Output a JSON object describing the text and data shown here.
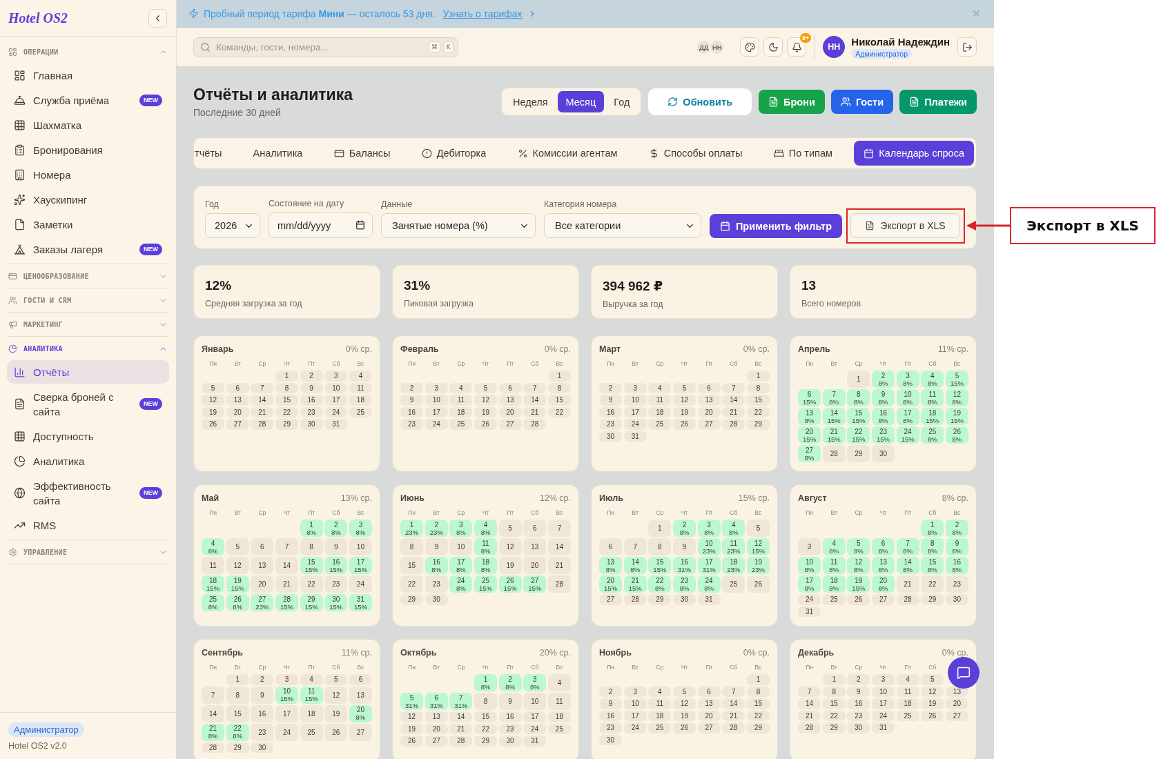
{
  "sidebar": {
    "logo": "Hotel OS2",
    "sections": [
      {
        "title": "ОПЕРАЦИИ",
        "expanded": true,
        "items": [
          {
            "label": "Главная",
            "selected": false
          },
          {
            "label": "Служба приёма",
            "badge": "NEW",
            "selected": false
          },
          {
            "label": "Шахматка",
            "selected": false
          },
          {
            "label": "Бронирования",
            "selected": false
          },
          {
            "label": "Номера",
            "selected": false
          },
          {
            "label": "Хаускипинг",
            "selected": false
          },
          {
            "label": "Заметки",
            "selected": false
          },
          {
            "label": "Заказы лагеря",
            "badge": "NEW",
            "selected": false
          }
        ]
      },
      {
        "title": "ЦЕНООБРАЗОВАНИЕ",
        "expanded": false
      },
      {
        "title": "ГОСТИ И CRM",
        "expanded": false
      },
      {
        "title": "МАРКЕТИНГ",
        "expanded": false
      },
      {
        "title": "АНАЛИТИКА",
        "expanded": true,
        "items": [
          {
            "label": "Отчёты",
            "selected": true
          },
          {
            "label": "Сверка броней с сайта",
            "badge": "NEW",
            "selected": false
          },
          {
            "label": "Доступность",
            "selected": false
          },
          {
            "label": "Аналитика",
            "selected": false
          },
          {
            "label": "Эффективность сайта",
            "badge": "NEW",
            "selected": false
          },
          {
            "label": "RMS",
            "selected": false
          }
        ]
      },
      {
        "title": "УПРАВЛЕНИЕ",
        "expanded": false
      }
    ],
    "footer": {
      "role": "Администратор",
      "version": "Hotel OS2 v2.0"
    }
  },
  "banner": {
    "text": "Пробный период тарифа **Мини** — осталось 53 дня.",
    "link": "Узнать о тарифах"
  },
  "header": {
    "search": {
      "placeholder": "Команды, гости, номера...",
      "keys": [
        "⌘",
        "K"
      ]
    },
    "presence": [
      "ДД",
      "НН"
    ],
    "notifications": "9+",
    "user": {
      "initials": "НН",
      "name": "Николай Надеждин",
      "role": "Администратор"
    }
  },
  "page": {
    "title": "Отчёты и аналитика",
    "subtitle": "Последние 30 дней",
    "periods": [
      {
        "label": "Неделя",
        "selected": false
      },
      {
        "label": "Месяц",
        "selected": true
      },
      {
        "label": "Год",
        "selected": false
      }
    ],
    "actions": [
      {
        "label": "Обновить",
        "kind": "refresh",
        "color": "#13819e"
      },
      {
        "label": "Брони",
        "kind": "bookings",
        "color": "#16a34a"
      },
      {
        "label": "Гости",
        "kind": "guests",
        "color": "#2563eb"
      },
      {
        "label": "Платежи",
        "kind": "payments",
        "color": "#059669"
      }
    ]
  },
  "tabs": [
    {
      "label": "тчёты",
      "selected": false
    },
    {
      "label": "Аналитика",
      "selected": false
    },
    {
      "label": "Балансы",
      "selected": false
    },
    {
      "label": "Дебиторка",
      "selected": false
    },
    {
      "label": "Комиссии агентам",
      "selected": false
    },
    {
      "label": "Способы оплаты",
      "selected": false
    },
    {
      "label": "По типам",
      "selected": false
    },
    {
      "label": "Календарь спроса",
      "selected": true
    }
  ],
  "filters": {
    "fields": [
      {
        "label": "Год",
        "kind": "select",
        "value": "2026"
      },
      {
        "label": "Состояние на дату",
        "kind": "date",
        "placeholder": "mm/dd/yyyy"
      },
      {
        "label": "Данные",
        "kind": "select",
        "value": "Занятые номера (%)"
      },
      {
        "label": "Категория номера",
        "kind": "select",
        "value": "Все категории"
      }
    ],
    "apply": "Применить фильтр",
    "export": "Экспорт в XLS"
  },
  "stats": [
    {
      "value": "12%",
      "label": "Средняя загрузка за год"
    },
    {
      "value": "31%",
      "label": "Пиковая загрузка"
    },
    {
      "value": "394 962 ₽",
      "label": "Выручка за год"
    },
    {
      "value": "13",
      "label": "Всего номеров"
    }
  ],
  "calendar": {
    "months": [
      {
        "name": "Январь",
        "average": "0% ср.",
        "weekdays": [
          "Пн",
          "Вт",
          "Ср",
          "Чт",
          "Пт",
          "Сб",
          "Вс"
        ],
        "days": [
          [
            "1"
          ],
          [
            "2"
          ],
          [
            "3"
          ],
          [
            "4"
          ],
          [
            "5"
          ],
          [
            "6"
          ],
          [
            "7"
          ],
          [
            "8"
          ],
          [
            "9"
          ],
          [
            "10"
          ],
          [
            "11"
          ],
          [
            "12"
          ],
          [
            "13"
          ],
          [
            "14"
          ],
          [
            "15"
          ],
          [
            "16"
          ],
          [
            "17"
          ],
          [
            "18"
          ],
          [
            "19"
          ],
          [
            "20"
          ],
          [
            "21"
          ],
          [
            "22"
          ],
          [
            "23"
          ],
          [
            "24"
          ],
          [
            "25"
          ],
          [
            "26"
          ],
          [
            "27"
          ],
          [
            "28"
          ],
          [
            "29"
          ],
          [
            "30"
          ],
          [
            "31"
          ]
        ]
      },
      {
        "name": "Февраль",
        "average": "0% ср.",
        "weekdays": [
          "Пн",
          "Вт",
          "Ср",
          "Чт",
          "Пт",
          "Сб",
          "Вс"
        ],
        "days": [
          [
            "1"
          ],
          [
            "2"
          ],
          [
            "3"
          ],
          [
            "4"
          ],
          [
            "5"
          ],
          [
            "6"
          ],
          [
            "7"
          ],
          [
            "8"
          ],
          [
            "9"
          ],
          [
            "10"
          ],
          [
            "11"
          ],
          [
            "12"
          ],
          [
            "13"
          ],
          [
            "14"
          ],
          [
            "15"
          ],
          [
            "16"
          ],
          [
            "17"
          ],
          [
            "18"
          ],
          [
            "19"
          ],
          [
            "20"
          ],
          [
            "21"
          ],
          [
            "22"
          ],
          [
            "23"
          ],
          [
            "24"
          ],
          [
            "25"
          ],
          [
            "26"
          ],
          [
            "27"
          ],
          [
            "28"
          ]
        ]
      },
      {
        "name": "Март",
        "average": "0% ср.",
        "weekdays": [
          "Пн",
          "Вт",
          "Ср",
          "Чт",
          "Пт",
          "Сб",
          "Вс"
        ],
        "days": [
          [
            "1"
          ],
          [
            "2"
          ],
          [
            "3"
          ],
          [
            "4"
          ],
          [
            "5"
          ],
          [
            "6"
          ],
          [
            "7"
          ],
          [
            "8"
          ],
          [
            "9"
          ],
          [
            "10"
          ],
          [
            "11"
          ],
          [
            "12"
          ],
          [
            "13"
          ],
          [
            "14"
          ],
          [
            "15"
          ],
          [
            "16"
          ],
          [
            "17"
          ],
          [
            "18"
          ],
          [
            "19"
          ],
          [
            "20"
          ],
          [
            "21"
          ],
          [
            "22"
          ],
          [
            "23"
          ],
          [
            "24"
          ],
          [
            "25"
          ],
          [
            "26"
          ],
          [
            "27"
          ],
          [
            "28"
          ],
          [
            "29"
          ],
          [
            "30"
          ],
          [
            "31"
          ]
        ]
      },
      {
        "name": "Апрель",
        "average": "11% ср.",
        "weekdays": [
          "Пн",
          "Вт",
          "Ср",
          "Чт",
          "Пт",
          "Сб",
          "Вс"
        ],
        "days": [
          [
            "1"
          ],
          [
            "2",
            "8%"
          ],
          [
            "3",
            "8%"
          ],
          [
            "4",
            "8%"
          ],
          [
            "5",
            "15%"
          ],
          [
            "6",
            "15%"
          ],
          [
            "7",
            "8%"
          ],
          [
            "8",
            "8%"
          ],
          [
            "9",
            "8%"
          ],
          [
            "10",
            "8%"
          ],
          [
            "11",
            "8%"
          ],
          [
            "12",
            "8%"
          ],
          [
            "13",
            "8%"
          ],
          [
            "14",
            "15%"
          ],
          [
            "15",
            "15%"
          ],
          [
            "16",
            "8%"
          ],
          [
            "17",
            "8%"
          ],
          [
            "18",
            "15%"
          ],
          [
            "19",
            "15%"
          ],
          [
            "20",
            "15%"
          ],
          [
            "21",
            "15%"
          ],
          [
            "22",
            "15%"
          ],
          [
            "23",
            "15%"
          ],
          [
            "24",
            "15%"
          ],
          [
            "25",
            "8%"
          ],
          [
            "26",
            "8%"
          ],
          [
            "27",
            "8%"
          ],
          [
            "28"
          ],
          [
            "29"
          ],
          [
            "30"
          ]
        ]
      },
      {
        "name": "Май",
        "average": "13% ср.",
        "weekdays": [
          "Пн",
          "Вт",
          "Ср",
          "Чт",
          "Пт",
          "Сб",
          "Вс"
        ],
        "days": [
          [
            "1",
            "8%"
          ],
          [
            "2",
            "8%"
          ],
          [
            "3",
            "8%"
          ],
          [
            "4",
            "8%"
          ],
          [
            "5"
          ],
          [
            "6"
          ],
          [
            "7"
          ],
          [
            "8"
          ],
          [
            "9"
          ],
          [
            "10"
          ],
          [
            "11"
          ],
          [
            "12"
          ],
          [
            "13"
          ],
          [
            "14"
          ],
          [
            "15",
            "15%"
          ],
          [
            "16",
            "15%"
          ],
          [
            "17",
            "15%"
          ],
          [
            "18",
            "15%"
          ],
          [
            "19",
            "15%"
          ],
          [
            "20"
          ],
          [
            "21"
          ],
          [
            "22"
          ],
          [
            "23"
          ],
          [
            "24"
          ],
          [
            "25",
            "8%"
          ],
          [
            "26",
            "8%"
          ],
          [
            "27",
            "23%"
          ],
          [
            "28",
            "15%"
          ],
          [
            "29",
            "15%"
          ],
          [
            "30",
            "15%"
          ],
          [
            "31",
            "15%"
          ]
        ]
      },
      {
        "name": "Июнь",
        "average": "12% ср.",
        "weekdays": [
          "Пн",
          "Вт",
          "Ср",
          "Чт",
          "Пт",
          "Сб",
          "Вс"
        ],
        "days": [
          [
            "1",
            "23%"
          ],
          [
            "2",
            "23%"
          ],
          [
            "3",
            "8%"
          ],
          [
            "4",
            "8%"
          ],
          [
            "5"
          ],
          [
            "6"
          ],
          [
            "7"
          ],
          [
            "8"
          ],
          [
            "9"
          ],
          [
            "10"
          ],
          [
            "11",
            "8%"
          ],
          [
            "12"
          ],
          [
            "13"
          ],
          [
            "14"
          ],
          [
            "15"
          ],
          [
            "16",
            "8%"
          ],
          [
            "17",
            "8%"
          ],
          [
            "18",
            "8%"
          ],
          [
            "19"
          ],
          [
            "20"
          ],
          [
            "21"
          ],
          [
            "22"
          ],
          [
            "23"
          ],
          [
            "24",
            "8%"
          ],
          [
            "25",
            "15%"
          ],
          [
            "26",
            "15%"
          ],
          [
            "27",
            "15%"
          ],
          [
            "28"
          ],
          [
            "29"
          ],
          [
            "30"
          ]
        ]
      },
      {
        "name": "Июль",
        "average": "15% ср.",
        "weekdays": [
          "Пн",
          "Вт",
          "Ср",
          "Чт",
          "Пт",
          "Сб",
          "Вс"
        ],
        "days": [
          [
            "1"
          ],
          [
            "2",
            "8%"
          ],
          [
            "3",
            "8%"
          ],
          [
            "4",
            "8%"
          ],
          [
            "5"
          ],
          [
            "6"
          ],
          [
            "7"
          ],
          [
            "8"
          ],
          [
            "9"
          ],
          [
            "10",
            "23%"
          ],
          [
            "11",
            "23%"
          ],
          [
            "12",
            "15%"
          ],
          [
            "13",
            "8%"
          ],
          [
            "14",
            "8%"
          ],
          [
            "15",
            "15%"
          ],
          [
            "16",
            "31%"
          ],
          [
            "17",
            "31%"
          ],
          [
            "18",
            "23%"
          ],
          [
            "19",
            "23%"
          ],
          [
            "20",
            "15%"
          ],
          [
            "21",
            "15%"
          ],
          [
            "22",
            "8%"
          ],
          [
            "23",
            "8%"
          ],
          [
            "24",
            "8%"
          ],
          [
            "25"
          ],
          [
            "26"
          ],
          [
            "27"
          ],
          [
            "28"
          ],
          [
            "29"
          ],
          [
            "30"
          ],
          [
            "31"
          ]
        ]
      },
      {
        "name": "Август",
        "average": "8% ср.",
        "weekdays": [
          "Пн",
          "Вт",
          "Ср",
          "Чт",
          "Пт",
          "Сб",
          "Вс"
        ],
        "days": [
          [
            "1",
            "8%"
          ],
          [
            "2",
            "8%"
          ],
          [
            "3"
          ],
          [
            "4",
            "8%"
          ],
          [
            "5",
            "8%"
          ],
          [
            "6",
            "8%"
          ],
          [
            "7",
            "8%"
          ],
          [
            "8",
            "8%"
          ],
          [
            "9",
            "8%"
          ],
          [
            "10",
            "8%"
          ],
          [
            "11",
            "8%"
          ],
          [
            "12",
            "8%"
          ],
          [
            "13",
            "8%"
          ],
          [
            "14",
            "8%"
          ],
          [
            "15",
            "8%"
          ],
          [
            "16",
            "8%"
          ],
          [
            "17",
            "8%"
          ],
          [
            "18",
            "8%"
          ],
          [
            "19",
            "15%"
          ],
          [
            "20",
            "8%"
          ],
          [
            "21"
          ],
          [
            "22"
          ],
          [
            "23"
          ],
          [
            "24"
          ],
          [
            "25"
          ],
          [
            "26"
          ],
          [
            "27"
          ],
          [
            "28"
          ],
          [
            "29"
          ],
          [
            "30"
          ],
          [
            "31"
          ]
        ]
      },
      {
        "name": "Сентябрь",
        "average": "11% ср.",
        "weekdays": [
          "Пн",
          "Вт",
          "Ср",
          "Чт",
          "Пт",
          "Сб",
          "Вс"
        ],
        "days": [
          [
            "1"
          ],
          [
            "2"
          ],
          [
            "3"
          ],
          [
            "4"
          ],
          [
            "5"
          ],
          [
            "6"
          ],
          [
            "7"
          ],
          [
            "8"
          ],
          [
            "9"
          ],
          [
            "10",
            "15%"
          ],
          [
            "11",
            "15%"
          ],
          [
            "12"
          ],
          [
            "13"
          ],
          [
            "14"
          ],
          [
            "15"
          ],
          [
            "16"
          ],
          [
            "17"
          ],
          [
            "18"
          ],
          [
            "19"
          ],
          [
            "20",
            "8%"
          ],
          [
            "21",
            "8%"
          ],
          [
            "22",
            "8%"
          ],
          [
            "23"
          ],
          [
            "24"
          ],
          [
            "25"
          ],
          [
            "26"
          ],
          [
            "27"
          ],
          [
            "28"
          ],
          [
            "29"
          ],
          [
            "30"
          ]
        ]
      },
      {
        "name": "Октябрь",
        "average": "20% ср.",
        "weekdays": [
          "Пн",
          "Вт",
          "Ср",
          "Чт",
          "Пт",
          "Сб",
          "Вс"
        ],
        "days": [
          [
            "1",
            "8%"
          ],
          [
            "2",
            "8%"
          ],
          [
            "3",
            "8%"
          ],
          [
            "4"
          ],
          [
            "5",
            "31%"
          ],
          [
            "6",
            "31%"
          ],
          [
            "7",
            "31%"
          ],
          [
            "8"
          ],
          [
            "9"
          ],
          [
            "10"
          ],
          [
            "11"
          ],
          [
            "12"
          ],
          [
            "13"
          ],
          [
            "14"
          ],
          [
            "15"
          ],
          [
            "16"
          ],
          [
            "17"
          ],
          [
            "18"
          ],
          [
            "19"
          ],
          [
            "20"
          ],
          [
            "21"
          ],
          [
            "22"
          ],
          [
            "23"
          ],
          [
            "24"
          ],
          [
            "25"
          ],
          [
            "26"
          ],
          [
            "27"
          ],
          [
            "28"
          ],
          [
            "29"
          ],
          [
            "30"
          ],
          [
            "31"
          ]
        ]
      },
      {
        "name": "Ноябрь",
        "average": "0% ср.",
        "weekdays": [
          "Пн",
          "Вт",
          "Ср",
          "Чт",
          "Пт",
          "Сб",
          "Вс"
        ],
        "days": [
          [
            "1"
          ],
          [
            "2"
          ],
          [
            "3"
          ],
          [
            "4"
          ],
          [
            "5"
          ],
          [
            "6"
          ],
          [
            "7"
          ],
          [
            "8"
          ],
          [
            "9"
          ],
          [
            "10"
          ],
          [
            "11"
          ],
          [
            "12"
          ],
          [
            "13"
          ],
          [
            "14"
          ],
          [
            "15"
          ],
          [
            "16"
          ],
          [
            "17"
          ],
          [
            "18"
          ],
          [
            "19"
          ],
          [
            "20"
          ],
          [
            "21"
          ],
          [
            "22"
          ],
          [
            "23"
          ],
          [
            "24"
          ],
          [
            "25"
          ],
          [
            "26"
          ],
          [
            "27"
          ],
          [
            "28"
          ],
          [
            "29"
          ],
          [
            "30"
          ]
        ]
      },
      {
        "name": "Декабрь",
        "average": "0% ср.",
        "weekdays": [
          "Пн",
          "Вт",
          "Ср",
          "Чт",
          "Пт",
          "Сб"
        ],
        "days": [
          [
            "1"
          ],
          [
            "2"
          ],
          [
            "3"
          ],
          [
            "4"
          ],
          [
            "5"
          ],
          [
            "7"
          ],
          [
            "8"
          ],
          [
            "9"
          ],
          [
            "10"
          ],
          [
            "11"
          ],
          [
            "12"
          ],
          [
            "13"
          ],
          [
            "14"
          ],
          [
            "15"
          ],
          [
            "16"
          ],
          [
            "17"
          ],
          [
            "18"
          ],
          [
            "19"
          ],
          [
            "20"
          ],
          [
            "21"
          ],
          [
            "22"
          ],
          [
            "23"
          ],
          [
            "24"
          ],
          [
            "25"
          ],
          [
            "26"
          ],
          [
            "27"
          ],
          [
            "28"
          ],
          [
            "29"
          ],
          [
            "30"
          ],
          [
            "31"
          ]
        ]
      }
    ]
  },
  "annotation": {
    "label": "Экспорт в XLS"
  }
}
